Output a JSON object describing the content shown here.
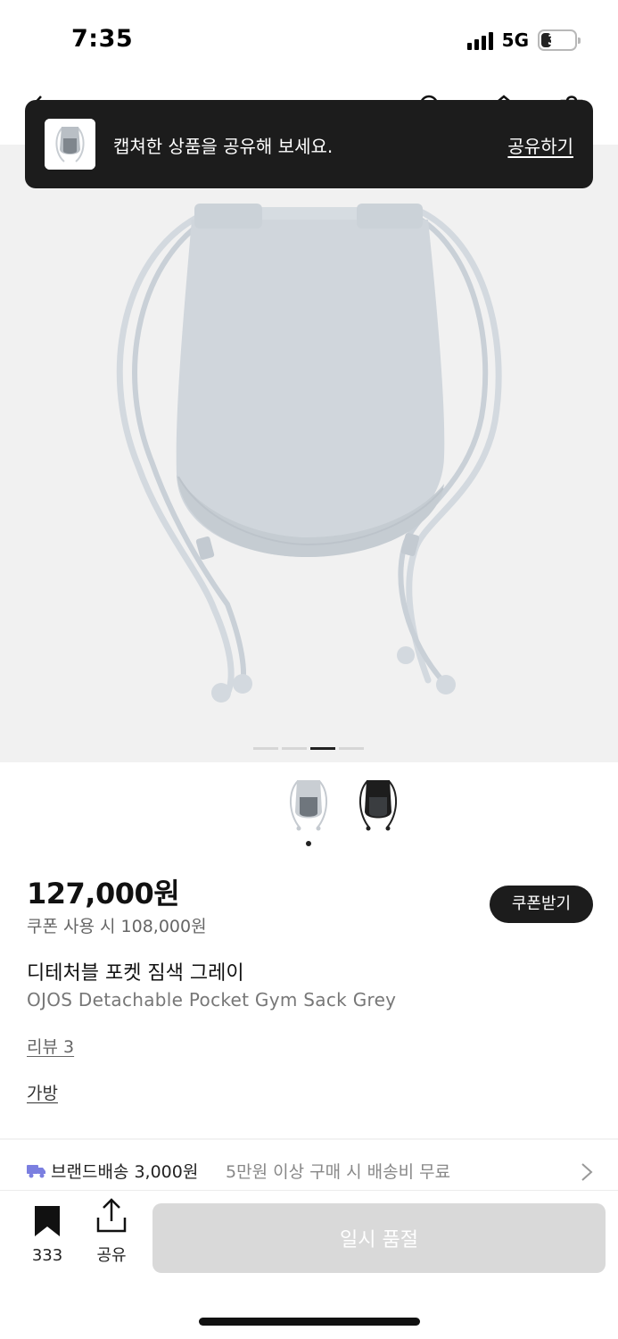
{
  "status_bar": {
    "time": "7:35",
    "network": "5G",
    "battery": "31",
    "battery_level": 0.31
  },
  "header": {
    "icons": [
      "back-arrow-icon",
      "search-icon",
      "home-icon",
      "cart-icon"
    ]
  },
  "toast": {
    "message": "캡쳐한 상품을 공유해 보세요.",
    "action_label": "공유하기"
  },
  "gallery": {
    "image": "gray-drawstring-gym-sack",
    "page_count": 4,
    "active_page": 3
  },
  "color_options": {
    "items": [
      "gray-gym-sack-thumbnail",
      "black-gym-sack-thumbnail"
    ],
    "selected_index": 0
  },
  "product": {
    "price": "127,000원",
    "coupon_price": "쿠폰 사용 시 108,000원",
    "coupon_button": "쿠폰받기",
    "title_ko": "디테처블 포켓 짐색 그레이",
    "title_en": "OJOS Detachable Pocket Gym Sack Grey",
    "review_link": "리뷰 3",
    "category_link": "가방"
  },
  "shipping": {
    "main": "브랜드배송 3,000원",
    "sub": "5만원 이상 구매 시 배송비 무료"
  },
  "bottom_bar": {
    "bookmark_count": "333",
    "share_label": "공유",
    "soldout_label": "일시 품절"
  },
  "colors": {
    "toast_bg": "#1c1c1c",
    "gallery_bg": "#f1f1f1",
    "soldout_bg": "#d9d9d9",
    "bag_gray": "#cfd5db",
    "shipping_icon": "#7b7fe0"
  }
}
